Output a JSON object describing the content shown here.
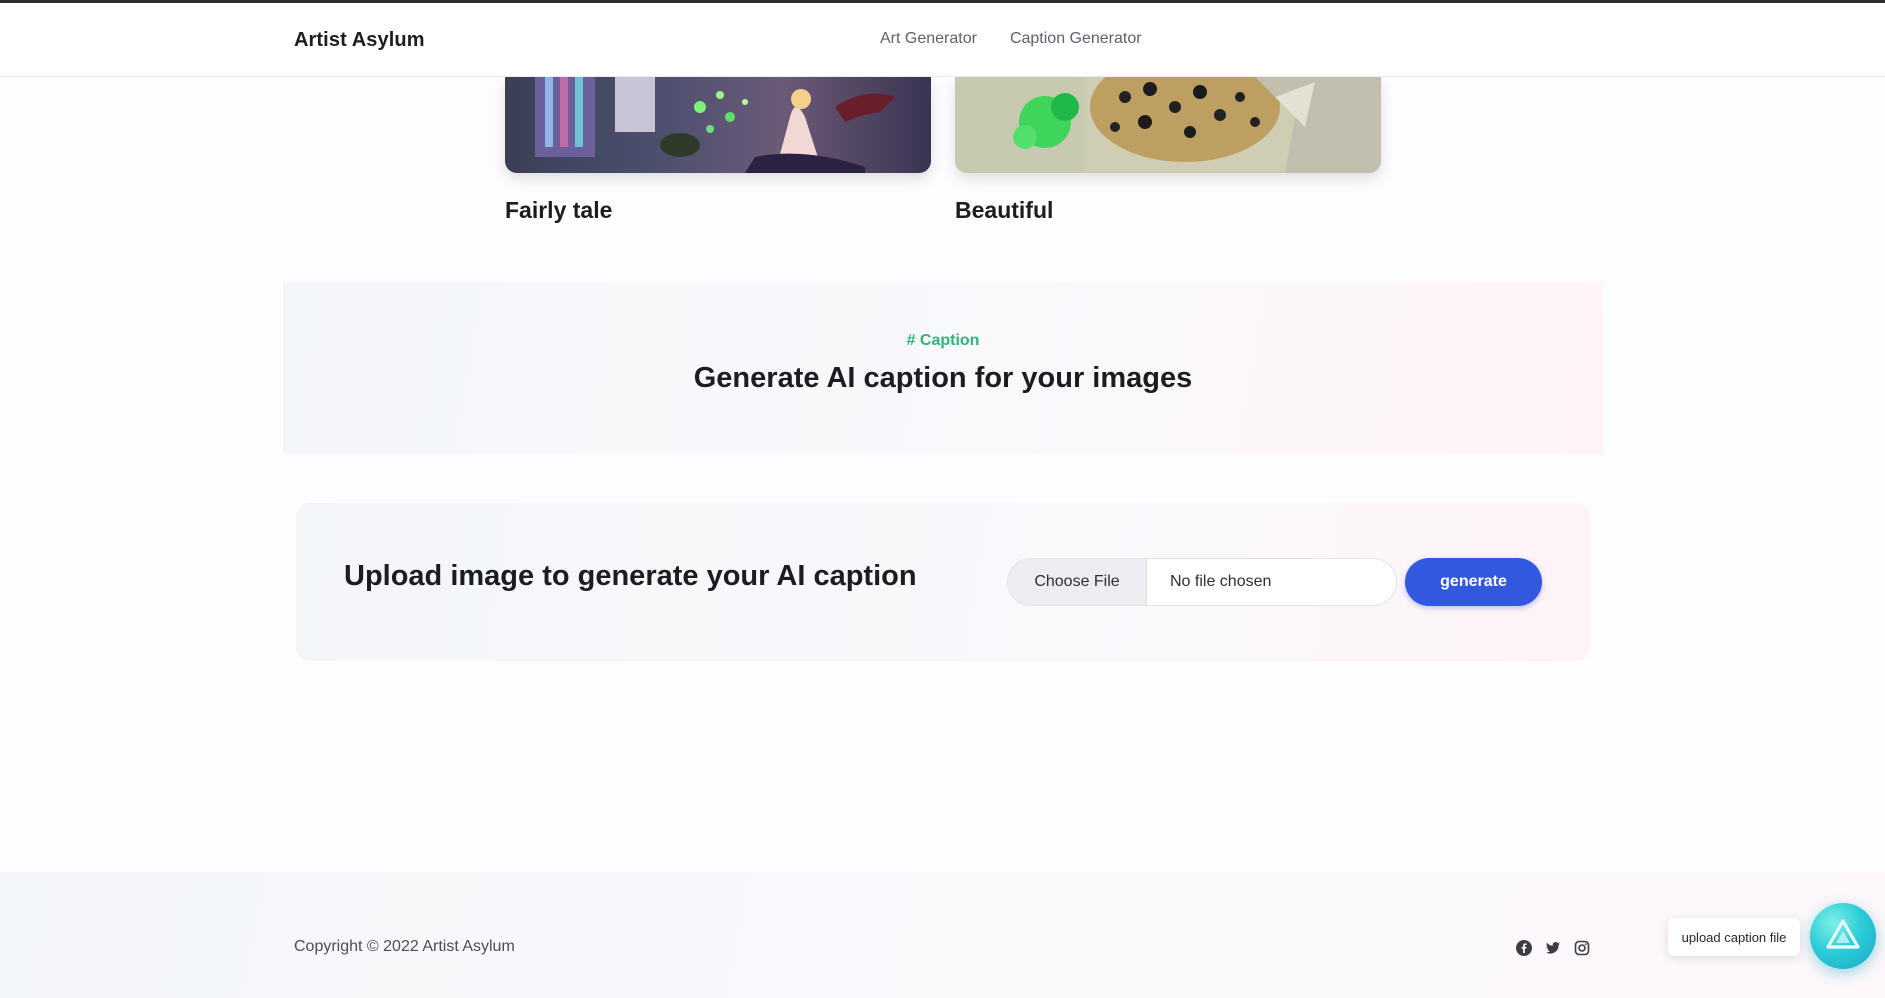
{
  "header": {
    "brand": "Artist Asylum",
    "nav": [
      "Art Generator",
      "Caption Generator"
    ]
  },
  "gallery": [
    {
      "title": "Fairly tale"
    },
    {
      "title": "Beautiful"
    }
  ],
  "caption_section": {
    "tag": "# Caption",
    "heading": "Generate AI caption for your images"
  },
  "upload": {
    "prompt": "Upload image to generate your AI caption",
    "choose_file_label": "Choose File",
    "file_status": "No file chosen",
    "generate_label": "generate"
  },
  "footer": {
    "copyright": "Copyright © 2022 Artist Asylum",
    "social_icons": [
      "facebook-icon",
      "twitter-icon",
      "instagram-icon"
    ]
  },
  "assistant": {
    "tooltip": "upload caption file"
  },
  "colors": {
    "accent_green": "#2fb57a",
    "primary_blue": "#3358e0",
    "assistant_teal": "#2ccdd8"
  }
}
